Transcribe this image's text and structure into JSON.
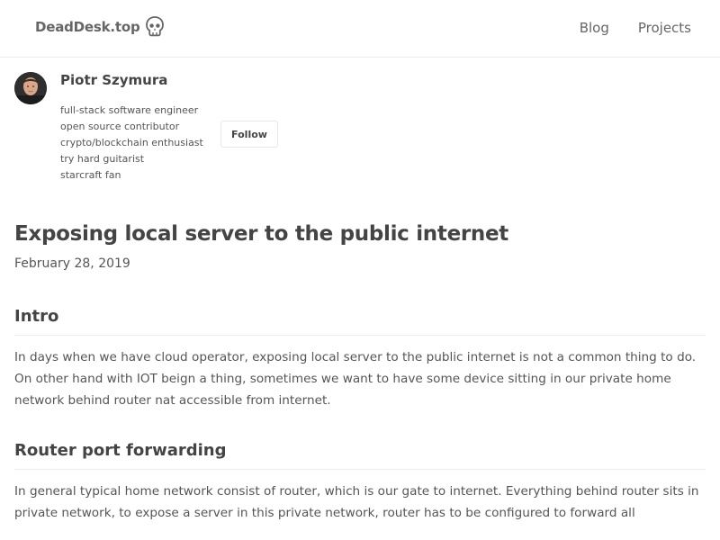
{
  "header": {
    "brand": "DeadDesk.top",
    "nav": [
      "Blog",
      "Projects"
    ]
  },
  "author": {
    "name": "Piotr Szymura",
    "bio": [
      "full-stack software engineer",
      "open source contributor",
      "crypto/blockchain enthusiast",
      "try hard guitarist",
      "starcraft fan"
    ],
    "follow_label": "Follow"
  },
  "article": {
    "title": "Exposing local server to the public internet",
    "date": "February 28, 2019",
    "sections": [
      {
        "heading": "Intro",
        "text": "In days when we have cloud operator, exposing local server to the public internet is not a common thing to do. On other hand with IOT beign a thing, sometimes we want to have some device sitting in our private home network behind router nat accessible from internet."
      },
      {
        "heading": "Router port forwarding",
        "text": "In general typical home network consist of router, which is our gate to internet. Everything behind router sits in private network, to expose a server in this private network, router has to be configured to forward all"
      }
    ]
  },
  "icons": {
    "brand": "skull-icon",
    "avatar": "avatar"
  }
}
